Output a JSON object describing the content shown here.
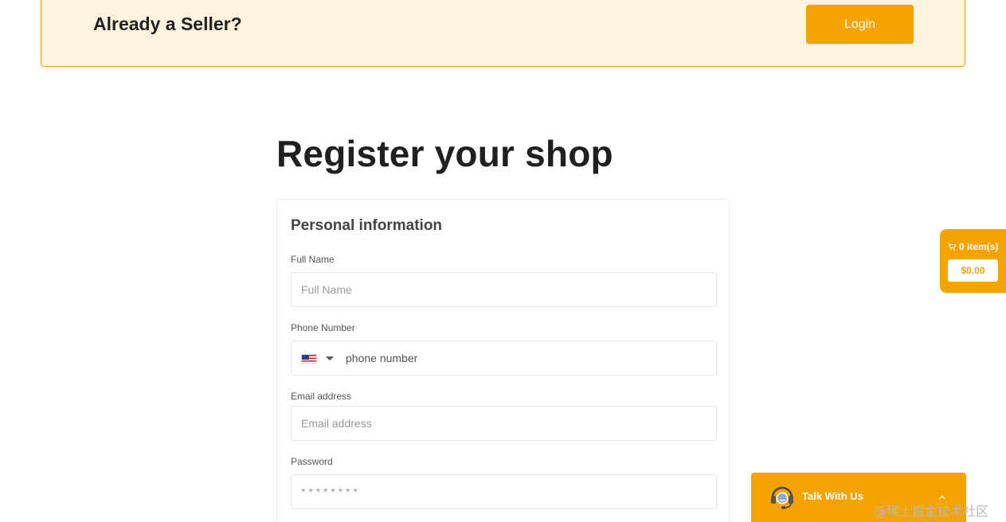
{
  "banner": {
    "title": "Already a Seller?",
    "login_label": "Login"
  },
  "page": {
    "title": "Register your shop"
  },
  "form": {
    "section_title": "Personal information",
    "full_name": {
      "label": "Full Name",
      "placeholder": "Full Name",
      "value": ""
    },
    "phone": {
      "label": "Phone Number",
      "placeholder": "phone number",
      "value": "",
      "country_icon": "us-flag-icon"
    },
    "email": {
      "label": "Email address",
      "placeholder": "Email address",
      "value": ""
    },
    "password": {
      "label": "Password",
      "placeholder": "* * * * * * * *",
      "value": ""
    }
  },
  "cart": {
    "count_label": "0 item(s)",
    "total": "$0.00",
    "icon": "cart-icon"
  },
  "chat": {
    "label": "Talk With Us",
    "icon": "headset-support-icon",
    "chevron": "chevron-up-icon"
  },
  "watermark": "@稀土掘金技术社区",
  "colors": {
    "accent": "#f5a300",
    "banner_bg": "#fff3dd",
    "banner_border": "#f2a106",
    "text_dark": "#212121",
    "border": "#e6e6e6"
  }
}
